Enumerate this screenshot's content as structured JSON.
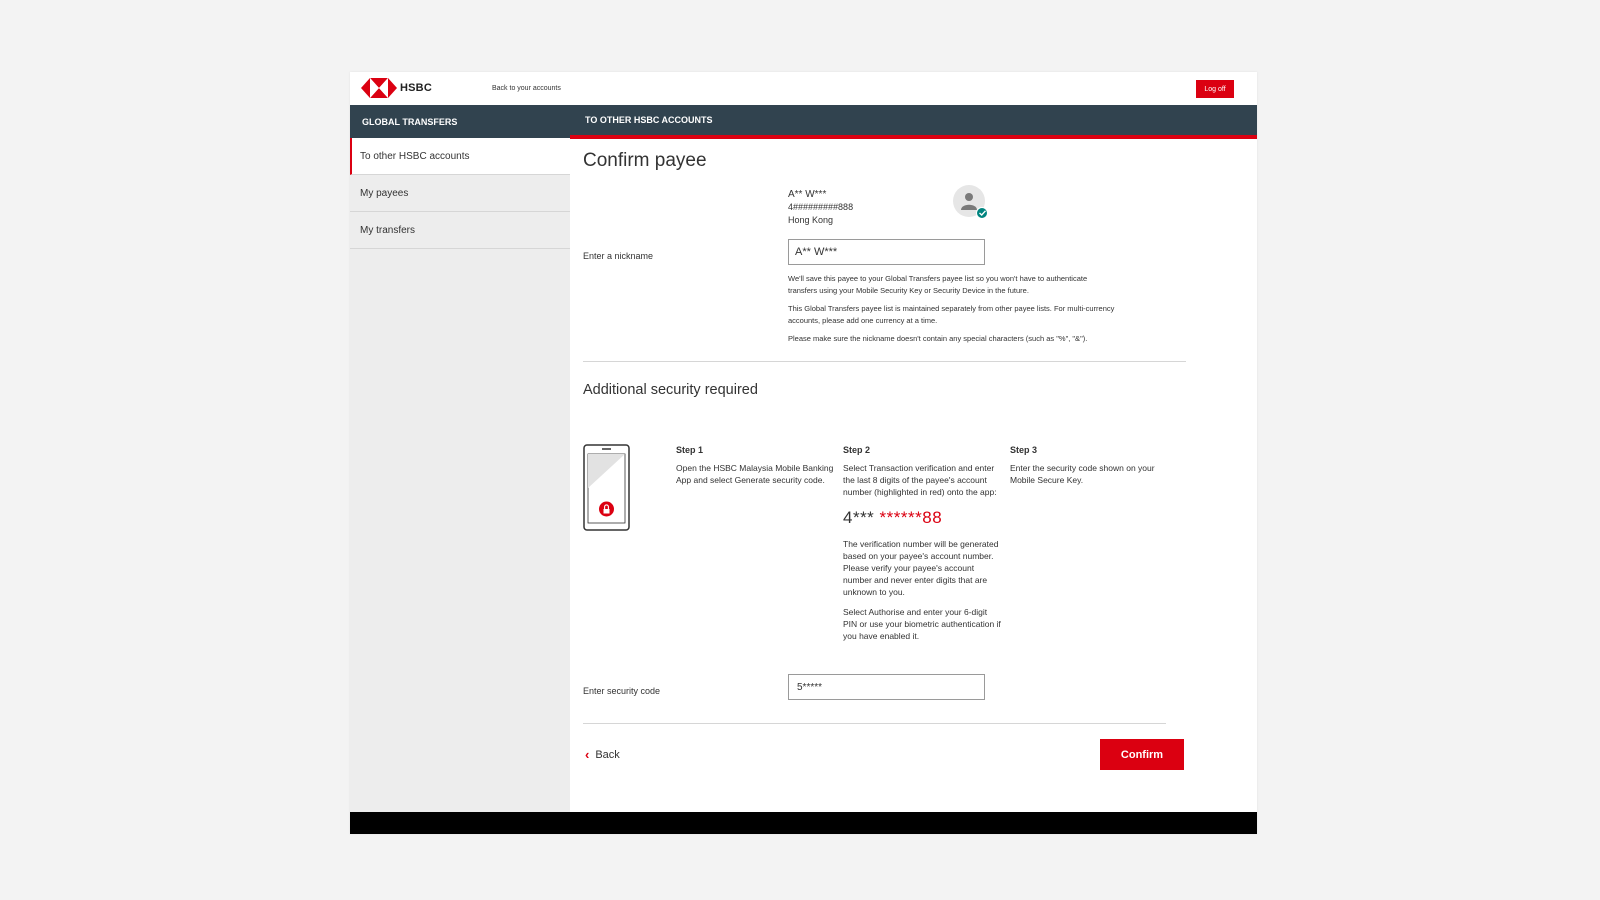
{
  "header": {
    "brand": "HSBC",
    "back_link": "Back to your accounts",
    "logoff": "Log off"
  },
  "sidebar": {
    "title": "GLOBAL TRANSFERS",
    "items": [
      {
        "label": "To other HSBC accounts",
        "active": true
      },
      {
        "label": "My payees",
        "active": false
      },
      {
        "label": "My transfers",
        "active": false
      }
    ]
  },
  "main": {
    "section_title": "TO OTHER HSBC ACCOUNTS",
    "page_title": "Confirm payee",
    "payee": {
      "name": "A** W***",
      "account": "4#########888",
      "location": "Hong Kong"
    },
    "nickname": {
      "label": "Enter a nickname",
      "value": "A** W***"
    },
    "notes": [
      "We'll save this payee to your Global Transfers payee list so you won't have to authenticate transfers using your Mobile Security Key or Security Device in the future.",
      "This Global Transfers payee list is maintained separately from other payee lists. For multi-currency accounts, please add one currency at a time.",
      "Please make sure the nickname doesn't contain any special characters (such as \"%\", \"&\")."
    ],
    "security": {
      "title": "Additional security required",
      "step1": {
        "heading": "Step 1",
        "text": "Open the HSBC Malaysia Mobile Banking App and select Generate security code."
      },
      "step2": {
        "heading": "Step 2",
        "text": "Select Transaction verification and enter the last 8 digits of the payee's account number (highlighted in red) onto the app:",
        "number_prefix": "4***",
        "number_highlight": "******88",
        "info1": "The verification number will be generated based on your payee's account number. Please verify your payee's account number and never enter digits that are unknown to you.",
        "info2": "Select Authorise and enter your 6-digit PIN or use your biometric authentication if you have enabled it."
      },
      "step3": {
        "heading": "Step 3",
        "text": "Enter the security code shown on your Mobile Secure Key."
      },
      "code_label": "Enter security code",
      "code_value": "5*****"
    },
    "actions": {
      "back": "Back",
      "confirm": "Confirm"
    }
  },
  "colors": {
    "brand_red": "#db0011",
    "nav_dark": "#31434f",
    "check_teal": "#00847f"
  },
  "icons": [
    "hsbc-hexagon-logo",
    "user-icon",
    "check-icon",
    "mobile-phone-lock-icon",
    "chevron-left-icon"
  ]
}
